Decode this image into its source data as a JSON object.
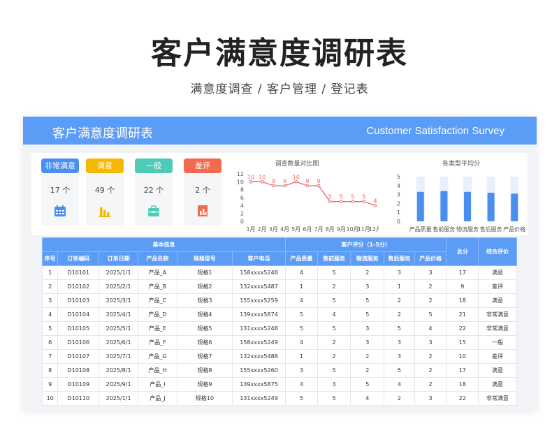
{
  "header": {
    "title": "客户满意度调研表",
    "subtitle": "满意度调查 / 客户管理 / 登记表"
  },
  "banner": {
    "title_cn": "客户满意度调研表",
    "title_en": "Customer Satisfaction Survey"
  },
  "summary_cards": [
    {
      "label": "非常满意",
      "count": "17 个",
      "color": "#4a8ef0",
      "icon": "calendar-icon"
    },
    {
      "label": "满意",
      "count": "49 个",
      "color": "#f5b800",
      "icon": "bar-chart-icon"
    },
    {
      "label": "一般",
      "count": "22 个",
      "color": "#4ecbb7",
      "icon": "briefcase-icon"
    },
    {
      "label": "差评",
      "count": "2 个",
      "color": "#f26b4f",
      "icon": "report-icon"
    }
  ],
  "chart_data": [
    {
      "type": "line",
      "title": "调查数量对比图",
      "categories": [
        "1月",
        "2月",
        "3月",
        "4月",
        "5月",
        "6月",
        "7月",
        "8月",
        "9月",
        "10月",
        "11月",
        "12月"
      ],
      "values": [
        10,
        10,
        9,
        9,
        10,
        9,
        9,
        5,
        5,
        5,
        5,
        4
      ],
      "yticks": [
        0,
        2,
        4,
        6,
        8,
        10,
        12
      ],
      "ylim": [
        0,
        12
      ],
      "color": "#e46a6a"
    },
    {
      "type": "bar",
      "title": "各类型平均分",
      "categories": [
        "产品质量",
        "售前服务",
        "物流服务",
        "售后服务",
        "产品价格"
      ],
      "values": [
        3.3,
        3.4,
        3.3,
        3.2,
        3.1
      ],
      "yticks": [
        0,
        1,
        2,
        3,
        4,
        5
      ],
      "ylim": [
        0,
        5
      ],
      "color": "#4a8ef0",
      "background_color": "#e8f0fd"
    }
  ],
  "table": {
    "group_headers": {
      "basic": "基本信息",
      "rating": "客户评分（1-5分）",
      "total": "总分",
      "overall": "综合评价"
    },
    "columns": [
      "序号",
      "订单编码",
      "订单日期",
      "产品名称",
      "规格型号",
      "客户电话",
      "产品质量",
      "售前服务",
      "物流服务",
      "售后服务",
      "产品价格"
    ],
    "rows": [
      [
        "1",
        "D10101",
        "2025/1/1",
        "产品_A",
        "规格1",
        "158xxxx5248",
        "4",
        "5",
        "2",
        "3",
        "3",
        "17",
        "满意"
      ],
      [
        "2",
        "D10102",
        "2025/2/1",
        "产品_B",
        "规格2",
        "132xxxx5487",
        "1",
        "2",
        "3",
        "1",
        "2",
        "9",
        "差评"
      ],
      [
        "3",
        "D10103",
        "2025/3/1",
        "产品_C",
        "规格3",
        "155xxxx5259",
        "4",
        "5",
        "5",
        "2",
        "2",
        "18",
        "满意"
      ],
      [
        "4",
        "D10104",
        "2025/4/1",
        "产品_D",
        "规格4",
        "139xxxx5874",
        "5",
        "4",
        "5",
        "2",
        "5",
        "21",
        "非常满意"
      ],
      [
        "5",
        "D10105",
        "2025/5/1",
        "产品_E",
        "规格5",
        "131xxxx5248",
        "5",
        "5",
        "3",
        "5",
        "4",
        "22",
        "非常满意"
      ],
      [
        "6",
        "D10106",
        "2025/6/1",
        "产品_F",
        "规格6",
        "158xxxx5249",
        "4",
        "2",
        "3",
        "3",
        "3",
        "15",
        "一般"
      ],
      [
        "7",
        "D10107",
        "2025/7/1",
        "产品_G",
        "规格7",
        "132xxxx5488",
        "1",
        "2",
        "2",
        "3",
        "2",
        "10",
        "差评"
      ],
      [
        "8",
        "D10108",
        "2025/8/1",
        "产品_H",
        "规格8",
        "155xxxx5260",
        "3",
        "5",
        "2",
        "5",
        "2",
        "17",
        "满意"
      ],
      [
        "9",
        "D10109",
        "2025/9/1",
        "产品_I",
        "规格9",
        "139xxxx5875",
        "4",
        "3",
        "5",
        "4",
        "2",
        "18",
        "满意"
      ],
      [
        "10",
        "D10110",
        "2025/1/1",
        "产品_J",
        "规格10",
        "131xxxx5249",
        "5",
        "5",
        "4",
        "2",
        "3",
        "22",
        "非常满意"
      ]
    ]
  }
}
